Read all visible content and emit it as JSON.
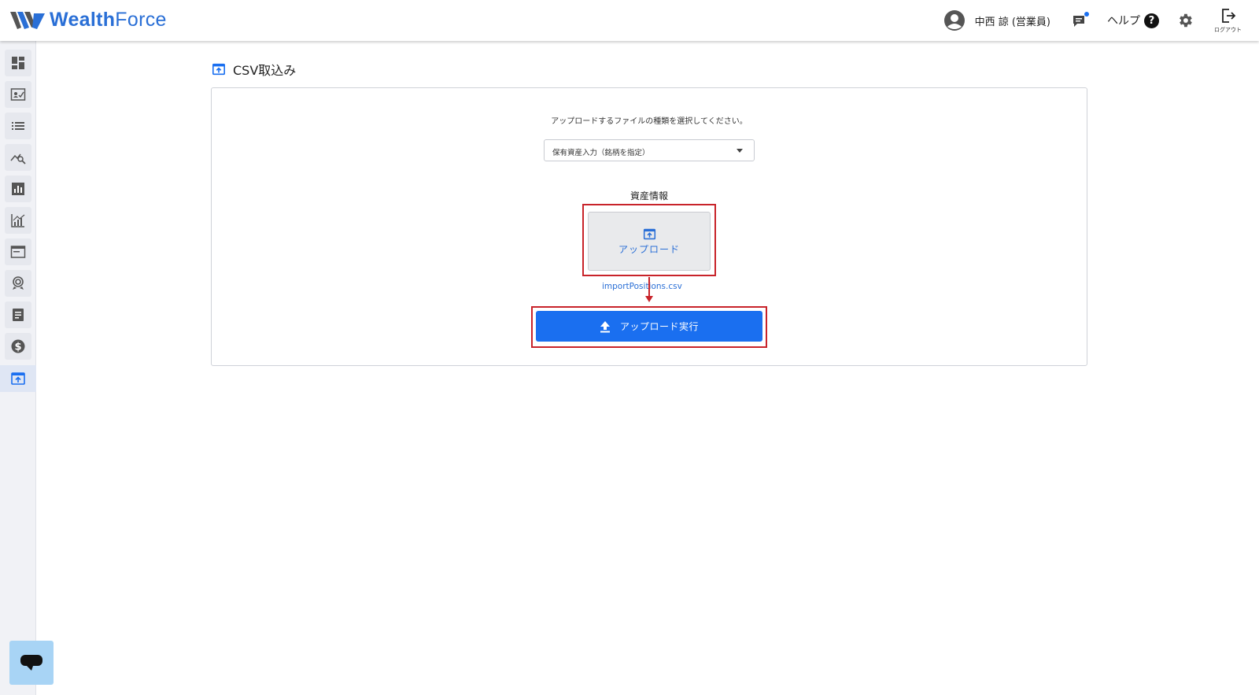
{
  "header": {
    "logo_text_bold": "Wealth",
    "logo_text_regular": "Force",
    "user_name": "中西 諒 (営業員)",
    "help_label": "ヘルプ",
    "help_icon": "?",
    "logout_label": "ログアウト"
  },
  "sidebar": {
    "items": [
      {
        "icon": "dashboard-icon"
      },
      {
        "icon": "customer-card-icon"
      },
      {
        "icon": "list-icon"
      },
      {
        "icon": "chart-search-icon"
      },
      {
        "icon": "bar-chart-icon"
      },
      {
        "icon": "analytics-icon"
      },
      {
        "icon": "window-icon"
      },
      {
        "icon": "rings-icon"
      },
      {
        "icon": "document-icon"
      },
      {
        "icon": "dollar-icon"
      },
      {
        "icon": "csv-import-icon",
        "active": true
      }
    ]
  },
  "page": {
    "title": "CSV取込み",
    "instruction": "アップロードするファイルの種類を選択してください。",
    "file_type_select": "保有資産入力（銘柄を指定）",
    "section_label": "資産情報",
    "upload_label": "アップロード",
    "filename": "importPositions.csv",
    "execute_label": "アップロード実行"
  },
  "colors": {
    "accent": "#1a6ff0",
    "brand": "#2a6fd6",
    "highlight": "#c8232a"
  }
}
